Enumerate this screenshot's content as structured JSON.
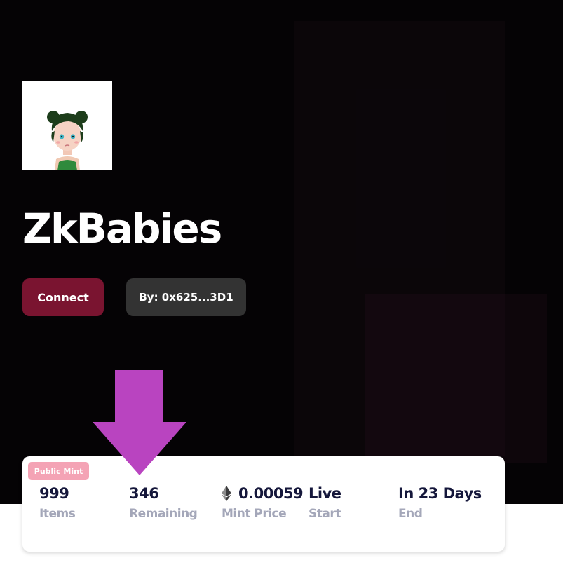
{
  "project": {
    "title": "ZkBabies",
    "logo_icon": "zkbaby-avatar-icon"
  },
  "actions": {
    "connect_label": "Connect",
    "creator_label": "By: 0x625...3D1"
  },
  "annotation": {
    "icon": "down-arrow-icon",
    "color": "#b944c0"
  },
  "stats": {
    "badge": "Public Mint",
    "items": [
      {
        "value": "999",
        "label": "Items"
      },
      {
        "value": "346",
        "label": "Remaining"
      },
      {
        "value": "0.00059",
        "label": "Mint Price",
        "icon": "ethereum-icon"
      },
      {
        "value": "Live",
        "label": "Start"
      },
      {
        "value": "In 23 Days",
        "label": "End"
      }
    ]
  },
  "colors": {
    "hero_background": "#050305",
    "connect_button": "#7a1430",
    "creator_button": "#333333",
    "badge": "#f4a3b5",
    "stat_value": "#15173b",
    "stat_label": "#a4a7b9"
  }
}
